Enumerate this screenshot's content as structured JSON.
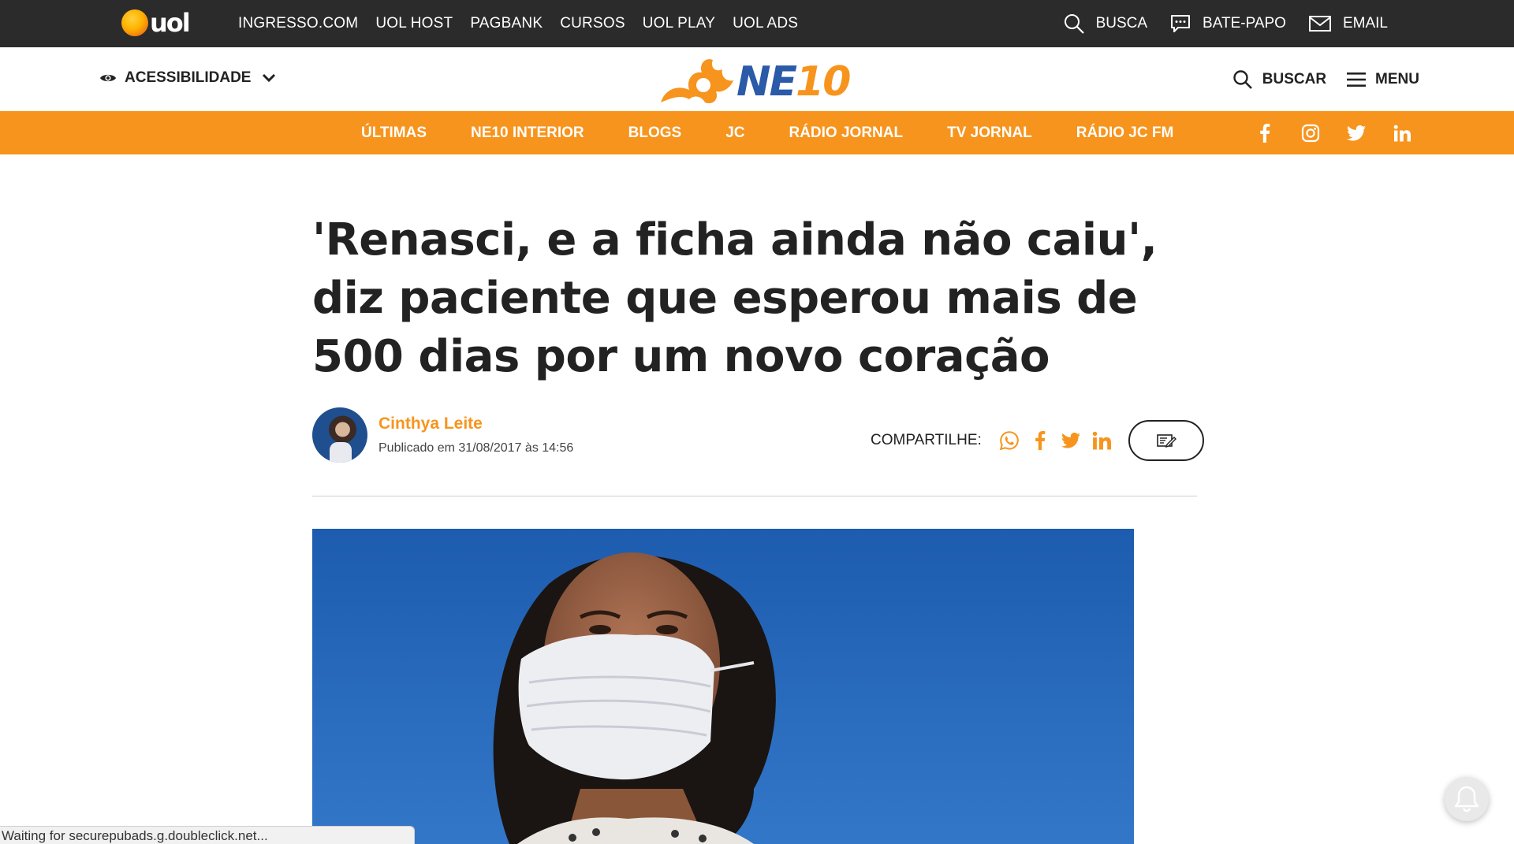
{
  "uol_bar": {
    "logo_text": "uol",
    "links": [
      "INGRESSO.COM",
      "UOL HOST",
      "PAGBANK",
      "CURSOS",
      "UOL PLAY",
      "UOL ADS"
    ],
    "right": {
      "search_label": "BUSCA",
      "chat_label": "BATE-PAPO",
      "email_label": "EMAIL"
    }
  },
  "header": {
    "accessibility_label": "ACESSIBILIDADE",
    "logo_ne": "NE",
    "logo_ten": "10",
    "search_label": "BUSCAR",
    "menu_label": "MENU"
  },
  "nav": {
    "links": [
      "ÚLTIMAS",
      "NE10 INTERIOR",
      "BLOGS",
      "JC",
      "RÁDIO JORNAL",
      "TV JORNAL",
      "RÁDIO JC FM"
    ],
    "social_icons": [
      "facebook-icon",
      "instagram-icon",
      "twitter-icon",
      "linkedin-icon"
    ]
  },
  "article": {
    "title": "'Renasci, e a ficha ainda não caiu', diz paciente que esperou mais de 500 dias por um novo coração",
    "author_name": "Cinthya Leite",
    "published": "Publicado em 31/08/2017 às 14:56",
    "share_label": "COMPARTILHE:",
    "share_icons": [
      "whatsapp-icon",
      "facebook-icon",
      "twitter-icon",
      "linkedin-icon"
    ]
  },
  "status_bar": {
    "text": "Waiting for securepubads.g.doubleclick.net..."
  },
  "colors": {
    "accent": "#f7941d",
    "uol_bar": "#2b2b2b",
    "logo_blue": "#2a5aa8"
  }
}
